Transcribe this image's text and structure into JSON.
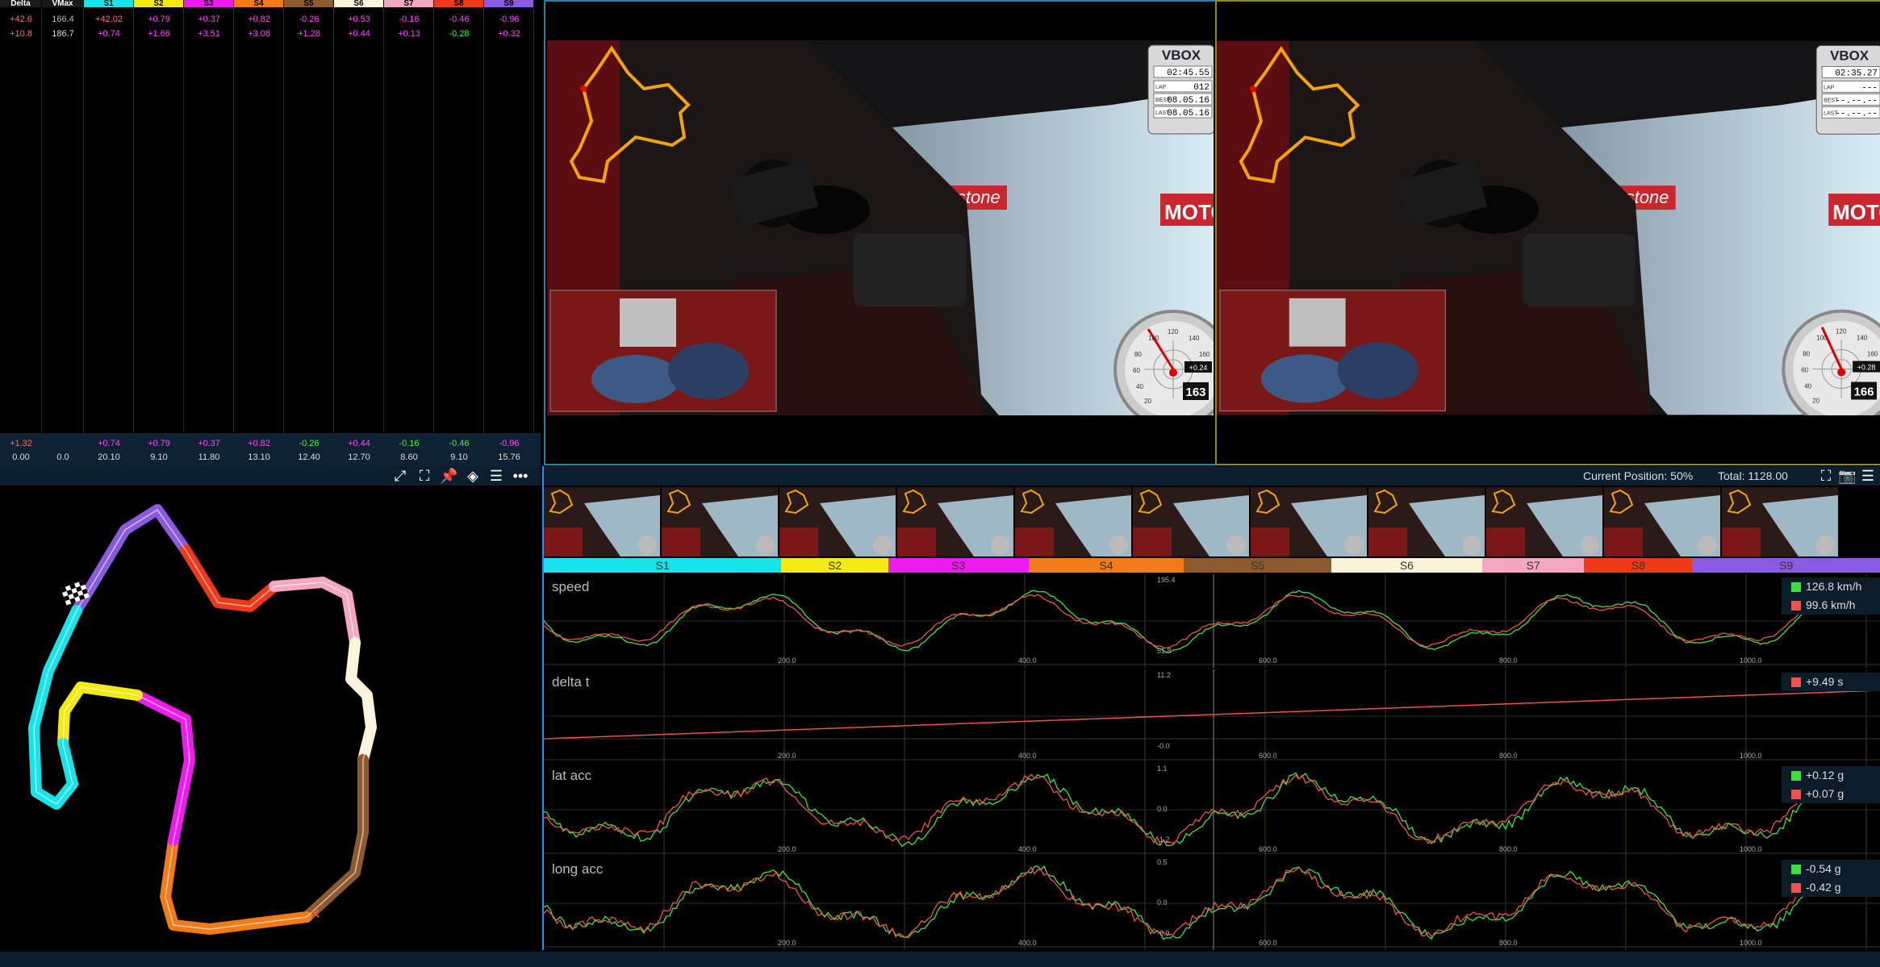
{
  "table": {
    "columns": [
      {
        "label": "Delta",
        "color": "#1a1a1a",
        "text": "#fff"
      },
      {
        "label": "VMax",
        "color": "#1a1a1a",
        "text": "#fff"
      },
      {
        "label": "S1",
        "color": "#18e2ea",
        "text": "#000"
      },
      {
        "label": "S2",
        "color": "#f2ea12",
        "text": "#000"
      },
      {
        "label": "S3",
        "color": "#ee1bee",
        "text": "#000"
      },
      {
        "label": "S4",
        "color": "#f07b18",
        "text": "#000"
      },
      {
        "label": "S5",
        "color": "#8c5a2e",
        "text": "#000"
      },
      {
        "label": "S6",
        "color": "#fbf4d8",
        "text": "#000"
      },
      {
        "label": "S7",
        "color": "#f4a7c0",
        "text": "#000"
      },
      {
        "label": "S8",
        "color": "#ee3a18",
        "text": "#000"
      },
      {
        "label": "S9",
        "color": "#8a5ae0",
        "text": "#000"
      }
    ],
    "rows": [
      [
        "+42.6",
        "166.4",
        "+42.02",
        "+0.79",
        "+0.37",
        "+0.82",
        "-0.26",
        "+0.53",
        "-0.16",
        "-0.46",
        "-0.96"
      ],
      [
        "+10.8",
        "186.7",
        "+0.74",
        "+1.66",
        "+3.51",
        "+3.08",
        "+1.28",
        "+0.44",
        "+0.13",
        "-0.28",
        "+0.32"
      ]
    ],
    "row_colors": [
      [
        "#ff6b6b",
        "#bbb",
        "#ff6b6b",
        "#ff44ff",
        "#ff44ff",
        "#ff44ff",
        "#ff44ff",
        "#ff44ff",
        "#ff44ff",
        "#ff44ff",
        "#ff44ff"
      ],
      [
        "#ff6b6b",
        "#ddd",
        "#ff44ff",
        "#ff44ff",
        "#ff44ff",
        "#ff44ff",
        "#ff44ff",
        "#ff44ff",
        "#ff44ff",
        "#44ee44",
        "#ff44ff"
      ]
    ],
    "totals": [
      "+1.32",
      "",
      "+0.74",
      "+0.79",
      "+0.37",
      "+0.82",
      "-0.26",
      "+0.44",
      "-0.16",
      "-0.46",
      "-0.96"
    ],
    "totals_colors": [
      "#ff6b6b",
      "#ff6b6b",
      "#ff44ff",
      "#ff44ff",
      "#ff44ff",
      "#ff44ff",
      "#44ee44",
      "#ff44ff",
      "#44ee44",
      "#44ee44",
      "#ff44ff"
    ],
    "times": [
      "0.00",
      "0.0",
      "20.10",
      "9.10",
      "11.80",
      "13.10",
      "12.40",
      "12.70",
      "8.60",
      "9.10",
      "15.76"
    ]
  },
  "videos": [
    {
      "vbox_logo": "VBOX",
      "clock": "02:45.55",
      "lap_label": "LAP",
      "lap": "012",
      "best_label": "BEST",
      "best": "08.05.16",
      "last_label": "LAST",
      "last": "08.05.16",
      "speed": "163",
      "delta": "+0.24",
      "gauge_ticks": [
        "20",
        "40",
        "60",
        "80",
        "100",
        "120",
        "140",
        "160"
      ],
      "banner": "Firestone",
      "banner2": "MOTO"
    },
    {
      "vbox_logo": "VBOX",
      "clock": "02:35.27",
      "lap_label": "LAP",
      "lap": "---",
      "best_label": "BEST",
      "best": "--.--.--",
      "last_label": "LAST",
      "last": "--.--.--",
      "speed": "166",
      "delta": "+0.28",
      "gauge_ticks": [
        "20",
        "40",
        "60",
        "80",
        "100",
        "120",
        "140",
        "160"
      ],
      "banner": "Firestone",
      "banner2": "MOTO"
    }
  ],
  "map_toolbar": {
    "icons": [
      "expand-icon",
      "fit-icon",
      "pin-icon",
      "paint-bucket-icon",
      "menu-icon",
      "more-icon"
    ]
  },
  "timeline": {
    "position_label": "Current Position: 50%",
    "total_label": "Total: 1128.00",
    "sectors": [
      {
        "name": "S1",
        "color": "#18e2ea",
        "w": 200
      },
      {
        "name": "S2",
        "color": "#f2ea12",
        "w": 90
      },
      {
        "name": "S3",
        "color": "#ee1bee",
        "w": 118
      },
      {
        "name": "S4",
        "color": "#f07b18",
        "w": 131
      },
      {
        "name": "S5",
        "color": "#8c5a2e",
        "w": 124
      },
      {
        "name": "S6",
        "color": "#fbf4d8",
        "w": 127
      },
      {
        "name": "S7",
        "color": "#f4a7c0",
        "w": 86
      },
      {
        "name": "S8",
        "color": "#ee3a18",
        "w": 91
      },
      {
        "name": "S9",
        "color": "#8a5ae0",
        "w": 158
      }
    ]
  },
  "graphs": [
    {
      "name": "speed",
      "ymax": "195.4",
      "ymin": "51.8",
      "x_ticks": [
        "200.0",
        "400.0",
        "600.0",
        "800.0",
        "1000.0"
      ],
      "legend": [
        {
          "color": "#3ee03e",
          "text": "126.8 km/h"
        },
        {
          "color": "#f05050",
          "text": "99.6 km/h"
        }
      ]
    },
    {
      "name": "delta t",
      "ymax": "11.2",
      "ymin": "-0.0",
      "x_ticks": [
        "200.0",
        "400.0",
        "600.0",
        "800.0",
        "1000.0"
      ],
      "legend": [
        {
          "color": "#f05050",
          "text": "+9.49 s"
        }
      ]
    },
    {
      "name": "lat acc",
      "ymax": "1.1",
      "ymid": "0.0",
      "ymin": "-1.2",
      "x_ticks": [
        "200.0",
        "400.0",
        "600.0",
        "800.0",
        "1000.0"
      ],
      "legend": [
        {
          "color": "#3ee03e",
          "text": "+0.12 g"
        },
        {
          "color": "#f05050",
          "text": "+0.07 g"
        }
      ]
    },
    {
      "name": "long acc",
      "ymax": "0.5",
      "ymid": "0.0",
      "ymin": "-0.9",
      "x_ticks": [
        "200.0",
        "400.0",
        "600.0",
        "800.0",
        "1000.0"
      ],
      "legend": [
        {
          "color": "#3ee03e",
          "text": "-0.54 g"
        },
        {
          "color": "#f05050",
          "text": "-0.42 g"
        }
      ]
    }
  ],
  "colors": {
    "accent": "#1e90ff",
    "panel": "#0c1f2e",
    "green_trace": "#3ee03e",
    "red_trace": "#f05050"
  }
}
